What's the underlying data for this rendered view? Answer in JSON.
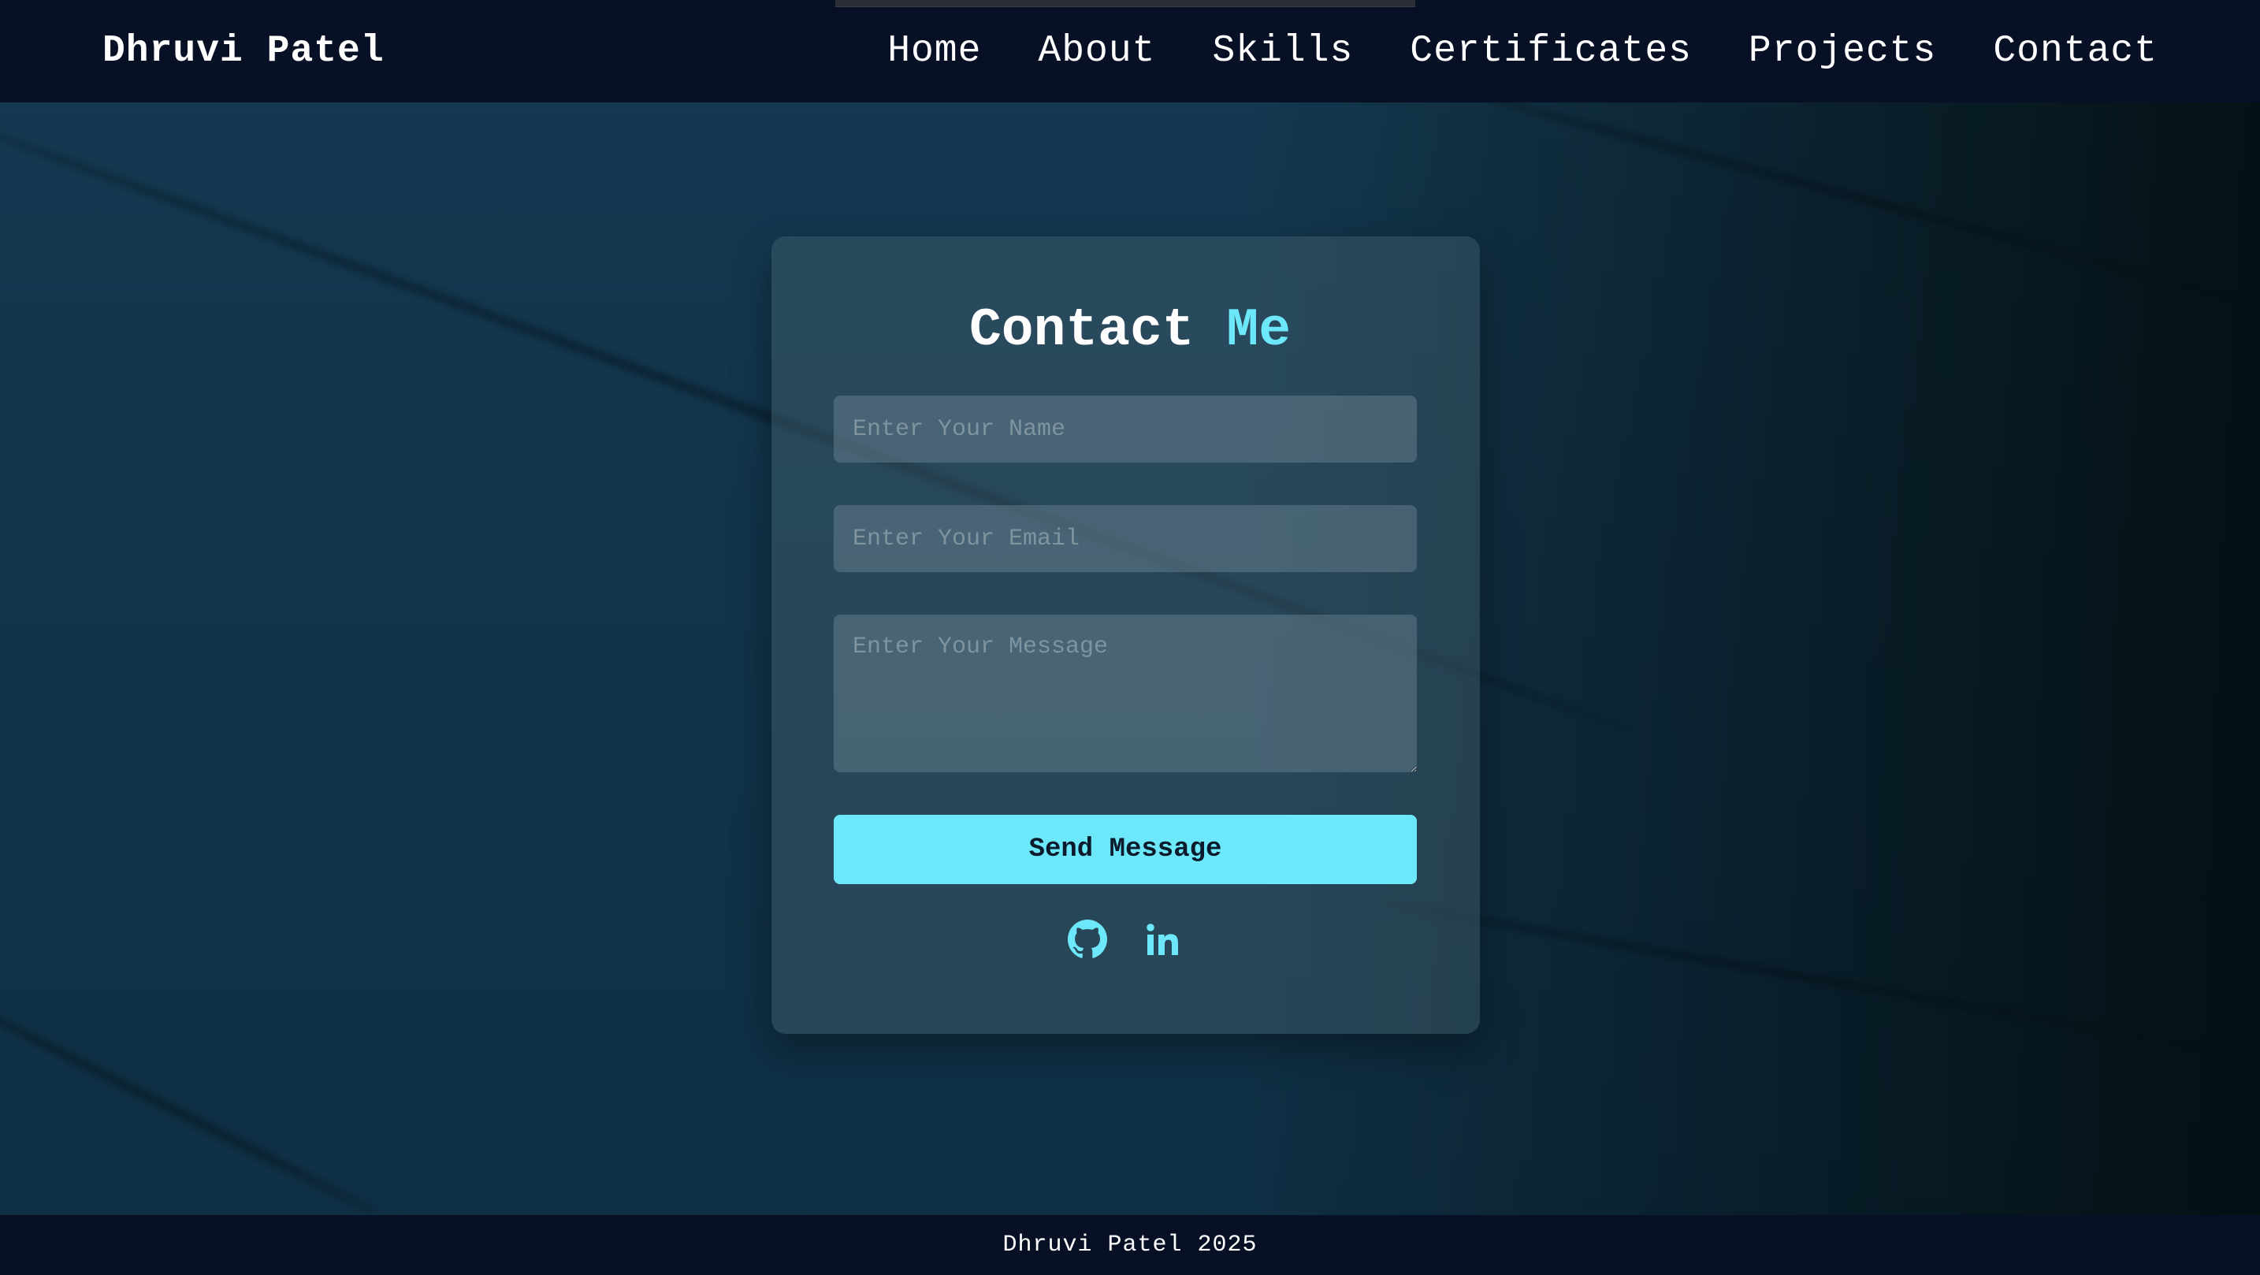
{
  "navbar": {
    "brand": "Dhruvi Patel",
    "links": [
      {
        "label": "Home"
      },
      {
        "label": "About"
      },
      {
        "label": "Skills"
      },
      {
        "label": "Certificates"
      },
      {
        "label": "Projects"
      },
      {
        "label": "Contact"
      }
    ]
  },
  "contact": {
    "title_main": "Contact",
    "title_accent": "Me",
    "name_placeholder": "Enter Your Name",
    "email_placeholder": "Enter Your Email",
    "message_placeholder": "Enter Your Message",
    "name_value": "",
    "email_value": "",
    "message_value": "",
    "send_label": "Send Message",
    "social_icons": [
      "github-icon",
      "linkedin-icon"
    ]
  },
  "footer": {
    "text": "Dhruvi Patel 2025"
  },
  "colors": {
    "accent": "#6de8fb",
    "navbar_bg": "#071024",
    "page_bg": "#123349"
  }
}
